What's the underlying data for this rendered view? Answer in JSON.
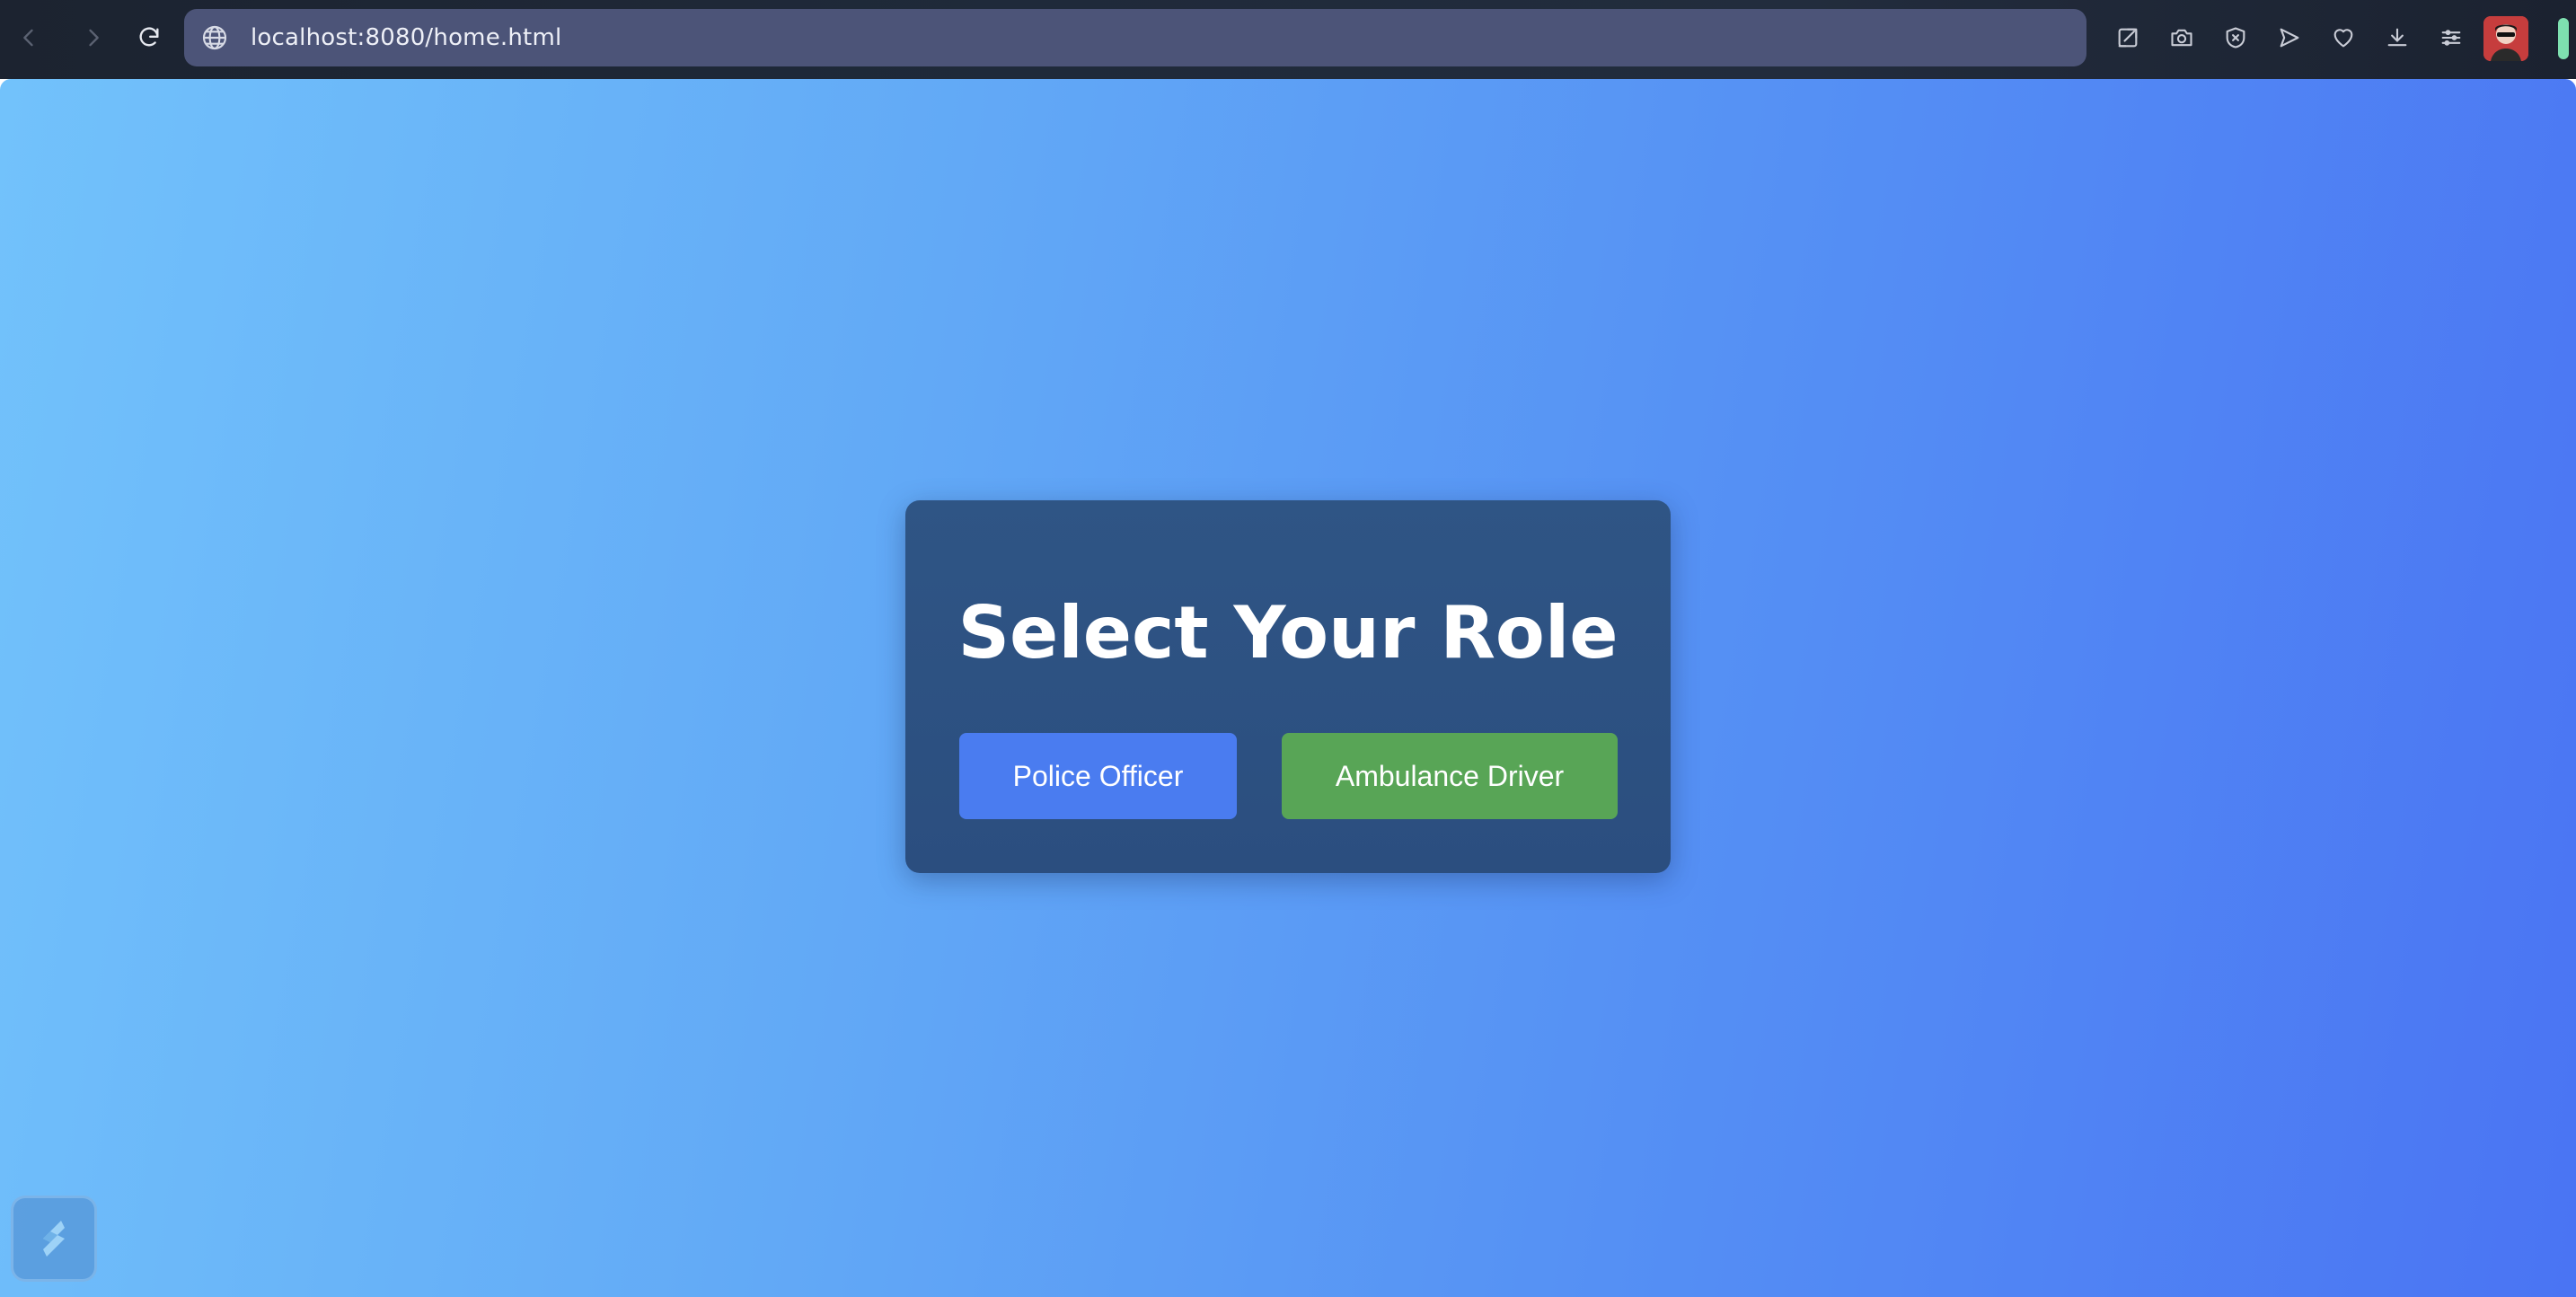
{
  "browser": {
    "url": "localhost:8080/home.html",
    "icons": {
      "back": "chevron-left-icon",
      "forward": "chevron-right-icon",
      "reload": "reload-icon",
      "site_info": "globe-icon",
      "toolbar": [
        "edit-icon",
        "camera-icon",
        "shield-icon",
        "send-icon",
        "heart-icon",
        "download-icon",
        "sliders-icon"
      ],
      "profile": "avatar"
    },
    "colors": {
      "url_bar": "#4c5478",
      "chrome": "#1f2a3a"
    }
  },
  "page": {
    "card": {
      "title": "Select Your Role",
      "buttons": {
        "police": "Police Officer",
        "ambulance": "Ambulance Driver"
      }
    },
    "floating_widget_icon": "app-launcher-icon",
    "colors": {
      "background_start": "#72c2fb",
      "background_end": "#4a74f3",
      "card": "#2d5282",
      "police_button": "#4a7cf0",
      "ambulance_button": "#58a556"
    }
  }
}
